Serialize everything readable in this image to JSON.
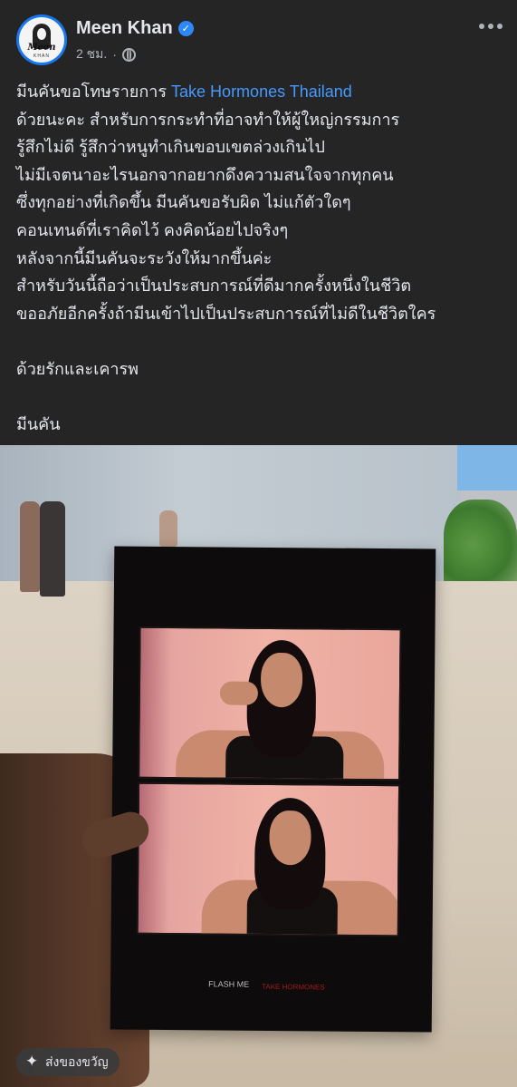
{
  "post": {
    "author": "Meen Khan",
    "time": "2 ชม.",
    "separator": "·",
    "text_lines": [
      "มีนคันขอโทษรายการ ",
      "ด้วยนะคะ สำหรับการกระทำที่อาจทำให้ผู้ใหญ่กรรมการ",
      "รู้สึกไม่ดี รู้สึกว่าหนูทำเกินขอบเขตล่วงเกินไป",
      "ไม่มีเจตนาอะไรนอกจากอยากดึงความสนใจจากทุกคน",
      "ซึ่งทุกอย่างที่เกิดขึ้น มีนคันขอรับผิด ไม่แก้ตัวใดๆ",
      "คอนเทนต์ที่เราคิดไว้ คงคิดน้อยไปจริงๆ",
      "หลังจากนี้มีนคันจะระวังให้มากขึ้นค่ะ",
      "สำหรับวันนี้ถือว่าเป็นประสบการณ์ที่ดีมากครั้งหนึ่งในชีวิต",
      "ขออภัยอีกครั้งถ้ามีนเข้าไปเป็นประสบการณ์ที่ไม่ดีในชีวิตใคร"
    ],
    "tagged_page": "Take Hormones Thailand",
    "closing": "ด้วยรักและเคารพ",
    "signature": "มีนคัน"
  },
  "avatar": {
    "logo_text": "Meen",
    "logo_sub": "KHAN"
  },
  "photo": {
    "card_logo_left": "FLASH ME",
    "card_logo_right": "TAKE HORMONES"
  },
  "actions": {
    "gift_label": "ส่งของขวัญ"
  },
  "colors": {
    "background": "#252526",
    "link": "#4599ff",
    "verified": "#2d88ff"
  }
}
